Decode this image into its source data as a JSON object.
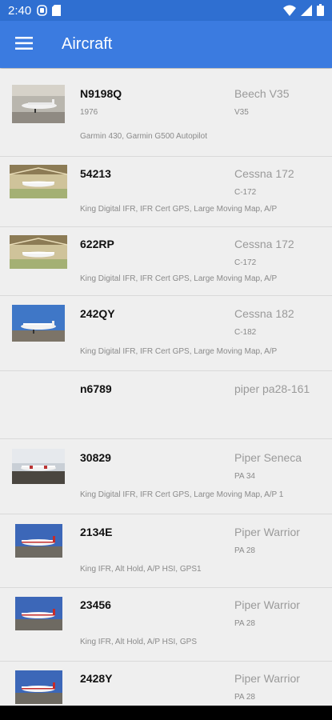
{
  "status": {
    "time": "2:40",
    "left_icons": [
      "sync-icon",
      "sd-card-icon"
    ],
    "right_icons": [
      "wifi-icon",
      "signal-icon",
      "battery-icon"
    ]
  },
  "app_bar": {
    "title": "Aircraft",
    "menu_icon": "hamburger-menu-icon"
  },
  "colors": {
    "status_bar": "#2f6fd1",
    "app_bar": "#3b7be0",
    "background": "#efefef"
  },
  "aircraft": [
    {
      "tail": "N9198Q",
      "model": "Beech V35",
      "year": "1976",
      "subtype": "V35",
      "equipment": "Garmin 430, Garmin G500 Autopilot",
      "photo": "hangar-plane-photo"
    },
    {
      "tail": "54213",
      "model": "Cessna 172",
      "year": "",
      "subtype": "C-172",
      "equipment": "King Digital IFR, IFR Cert GPS, Large Moving Map, A/P",
      "photo": "hangar-plane-photo"
    },
    {
      "tail": "622RP",
      "model": "Cessna 172",
      "year": "",
      "subtype": "C-172",
      "equipment": "King Digital IFR, IFR Cert GPS, Large Moving Map, A/P",
      "photo": "hangar-plane-photo"
    },
    {
      "tail": "242QY",
      "model": "Cessna 182",
      "year": "",
      "subtype": "C-182",
      "equipment": "King Digital IFR, IFR Cert GPS, Large Moving Map, A/P",
      "photo": "sky-plane-photo"
    },
    {
      "tail": "n6789",
      "model": "piper pa28-161",
      "year": "",
      "subtype": "",
      "equipment": "",
      "photo": ""
    },
    {
      "tail": "30829",
      "model": "Piper Seneca",
      "year": "",
      "subtype": "PA 34",
      "equipment": "King Digital IFR, IFR Cert GPS, Large Moving Map, A/P 1",
      "photo": "ramp-plane-photo"
    },
    {
      "tail": "2134E",
      "model": "Piper Warrior",
      "year": "",
      "subtype": "PA 28",
      "equipment": "King IFR, Alt Hold, A/P HSI, GPS1",
      "photo": "red-white-plane-photo"
    },
    {
      "tail": "23456",
      "model": "Piper Warrior",
      "year": "",
      "subtype": "PA 28",
      "equipment": "King IFR, Alt Hold, A/P HSI, GPS",
      "photo": "red-white-plane-photo"
    },
    {
      "tail": "2428Y",
      "model": "Piper Warrior",
      "year": "",
      "subtype": "PA 28",
      "equipment": "",
      "photo": "red-white-plane-photo"
    }
  ]
}
